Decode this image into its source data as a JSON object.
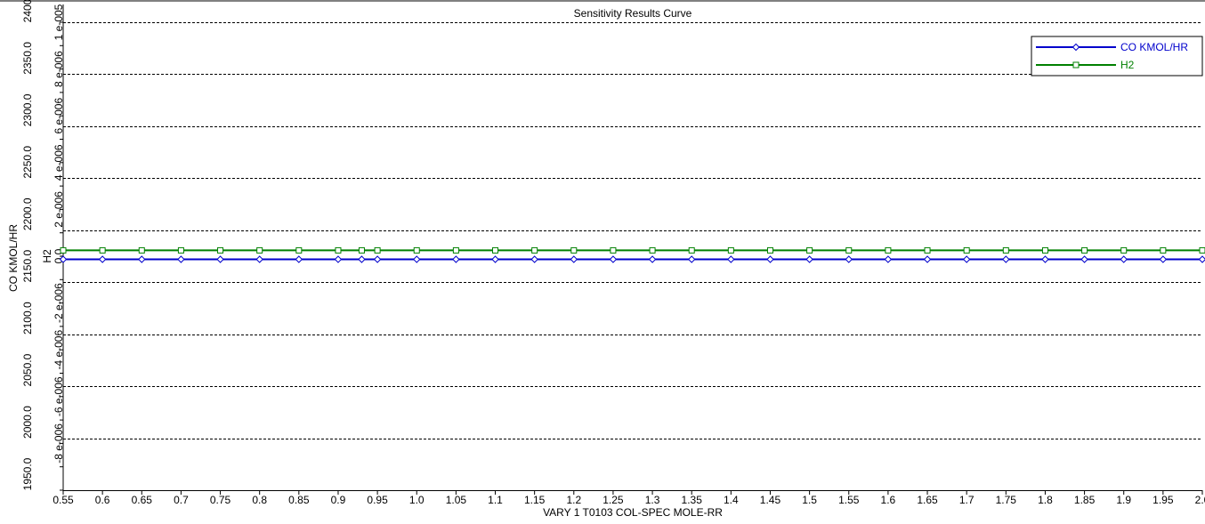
{
  "chart_data": {
    "type": "line",
    "title": "Sensitivity Results Curve",
    "xlabel": "VARY   1 T0103 COL-SPEC MOLE-RR",
    "ylabel_left": "CO KMOL/HR",
    "ylabel_right": "H2",
    "xlim": [
      0.55,
      2.0
    ],
    "x_ticks": [
      "0.55",
      "0.6",
      "0.65",
      "0.7",
      "0.75",
      "0.8",
      "0.85",
      "0.9",
      "0.95",
      "1.0",
      "1.05",
      "1.1",
      "1.15",
      "1.2",
      "1.25",
      "1.3",
      "1.35",
      "1.4",
      "1.45",
      "1.5",
      "1.55",
      "1.6",
      "1.65",
      "1.7",
      "1.75",
      "1.8",
      "1.85",
      "1.9",
      "1.95",
      "2.0"
    ],
    "y_left_lim": [
      1950.0,
      2400.0
    ],
    "y_left_ticks": [
      "1950.0",
      "2000.0",
      "2050.0",
      "2100.0",
      "2150.0",
      "2200.0",
      "2250.0",
      "2300.0",
      "2350.0",
      "2400.0"
    ],
    "y_right_lim": [
      -1e-05,
      1e-05
    ],
    "y_right_ticks": [
      "-8 e-006",
      "-6 e-006",
      "-4 e-006",
      "-2 e-006",
      "0.0",
      "2 e-006",
      "4 e-006",
      "6 e-006",
      "8 e-006",
      "1 e-005"
    ],
    "grid": "dashed horizontal",
    "legend_position": "top-right",
    "series": [
      {
        "name": "CO KMOL/HR",
        "axis": "left",
        "color": "#0000cc",
        "marker": "diamond",
        "x": [
          0.55,
          0.6,
          0.65,
          0.7,
          0.75,
          0.8,
          0.85,
          0.9,
          0.93,
          0.95,
          1.0,
          1.05,
          1.1,
          1.15,
          1.2,
          1.25,
          1.3,
          1.35,
          1.4,
          1.45,
          1.5,
          1.55,
          1.6,
          1.65,
          1.7,
          1.75,
          1.8,
          1.85,
          1.9,
          1.95,
          2.0
        ],
        "values": [
          2172,
          2172,
          2172,
          2172,
          2172,
          2172,
          2172,
          2172,
          2172,
          2172,
          2172,
          2172,
          2172,
          2172,
          2172,
          2172,
          2172,
          2172,
          2172,
          2172,
          2172,
          2172,
          2172,
          2172,
          2172,
          2172,
          2172,
          2172,
          2172,
          2172,
          2172
        ]
      },
      {
        "name": "H2",
        "axis": "right",
        "color": "#008000",
        "marker": "square",
        "x": [
          0.55,
          0.6,
          0.65,
          0.7,
          0.75,
          0.8,
          0.85,
          0.9,
          0.93,
          0.95,
          1.0,
          1.05,
          1.1,
          1.15,
          1.2,
          1.25,
          1.3,
          1.35,
          1.4,
          1.45,
          1.5,
          1.55,
          1.6,
          1.65,
          1.7,
          1.75,
          1.8,
          1.85,
          1.9,
          1.95,
          2.0
        ],
        "values": [
          2.5e-07,
          2.5e-07,
          2.5e-07,
          2.5e-07,
          2.5e-07,
          2.5e-07,
          2.5e-07,
          2.5e-07,
          2.5e-07,
          2.5e-07,
          2.5e-07,
          2.5e-07,
          2.5e-07,
          2.5e-07,
          2.5e-07,
          2.5e-07,
          2.5e-07,
          2.5e-07,
          2.5e-07,
          2.5e-07,
          2.5e-07,
          2.5e-07,
          2.5e-07,
          2.5e-07,
          2.5e-07,
          2.5e-07,
          2.5e-07,
          2.5e-07,
          2.5e-07,
          2.5e-07,
          2.5e-07
        ]
      }
    ]
  }
}
